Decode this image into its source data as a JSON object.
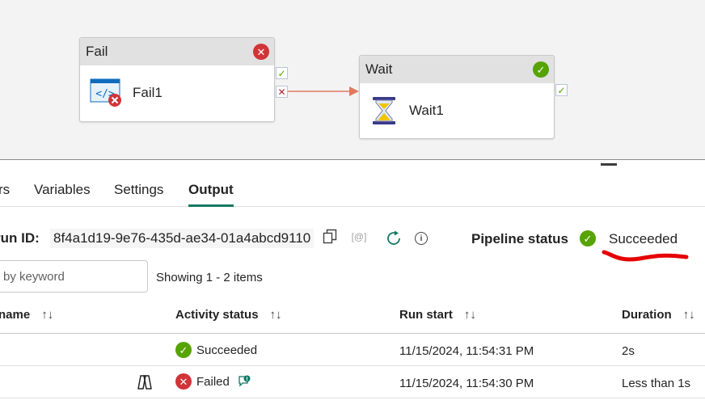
{
  "canvas": {
    "fail_node": {
      "title": "Fail",
      "activity": "Fail1",
      "status_color": "#d13438"
    },
    "wait_node": {
      "title": "Wait",
      "activity": "Wait1",
      "status_color": "#57a300"
    },
    "connector_color": "#e07a5f"
  },
  "tabs": [
    {
      "label": "rs"
    },
    {
      "label": "Variables"
    },
    {
      "label": "Settings"
    },
    {
      "label": "Output",
      "active": true
    }
  ],
  "run": {
    "label": "run ID:",
    "id": "8f4a1d19-9e76-435d-ae34-01a4abcd9110",
    "pipeline_status_label": "Pipeline status",
    "pipeline_status": "Succeeded",
    "annotation_color": "#e60000"
  },
  "search": {
    "placeholder": "by keyword"
  },
  "showing": "Showing 1 - 2 items",
  "table": {
    "columns": [
      "name",
      "Activity status",
      "Run start",
      "Duration"
    ],
    "rows": [
      {
        "status": "Succeeded",
        "status_icon": "check-circle-icon",
        "run_start": "11/15/2024, 11:54:31 PM",
        "duration": "2s"
      },
      {
        "status": "Failed",
        "status_icon": "error-circle-icon",
        "run_start": "11/15/2024, 11:54:30 PM",
        "duration": "Less than 1s"
      }
    ]
  },
  "colors": {
    "success": "#57a300",
    "error": "#d13438",
    "accent": "#117865"
  }
}
